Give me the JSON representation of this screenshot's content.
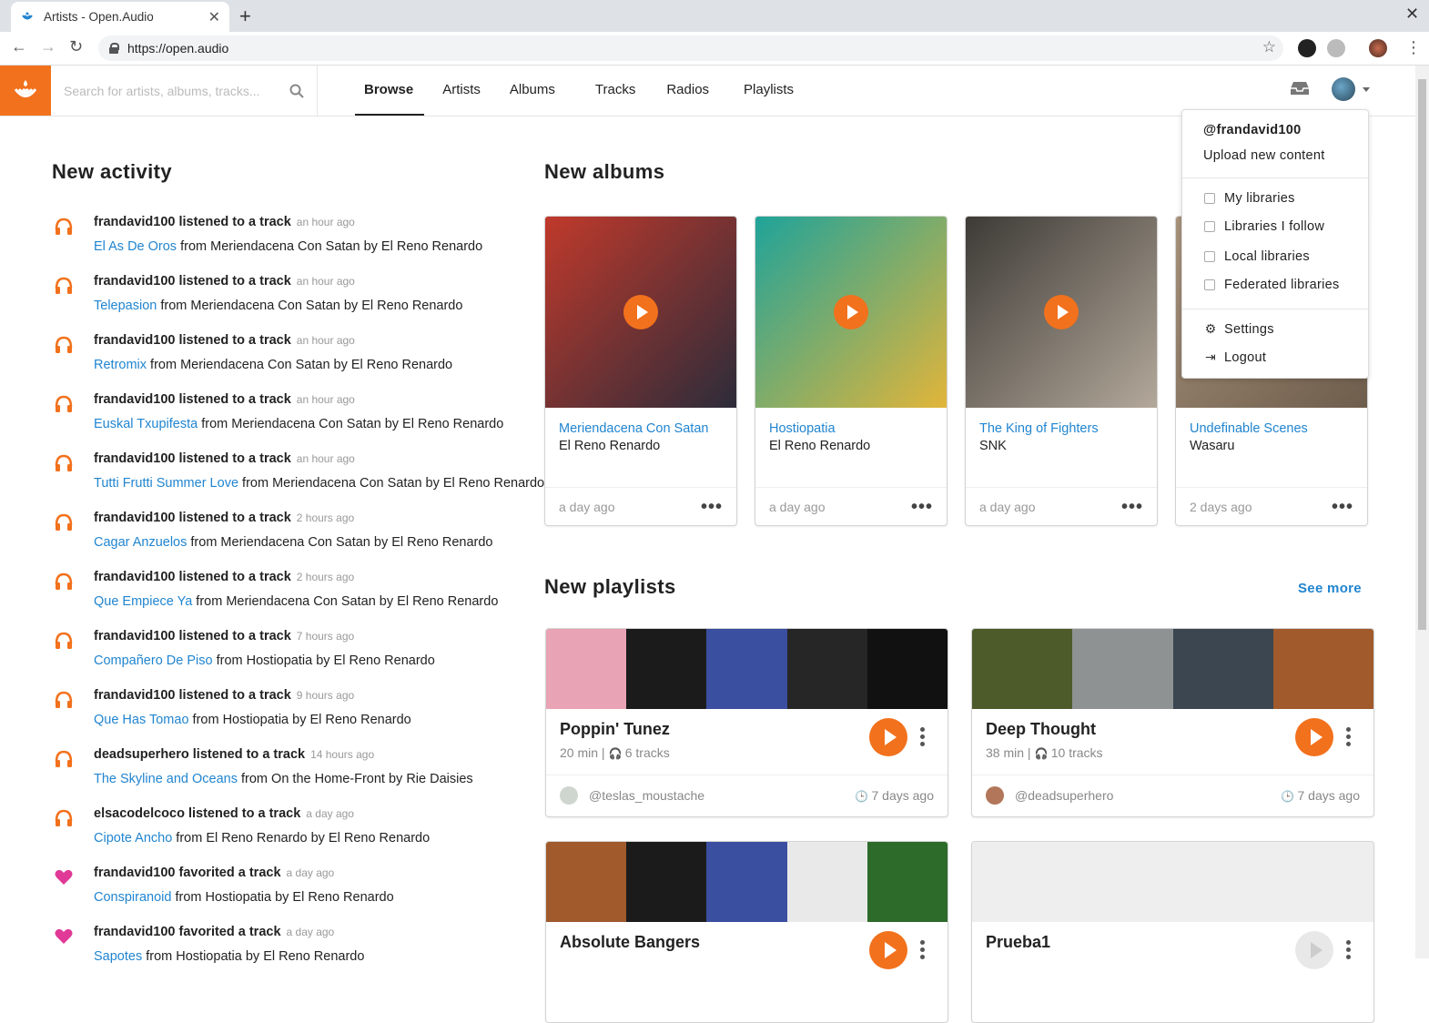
{
  "browser": {
    "tab_title": "Artists - Open.Audio",
    "url": "https://open.audio",
    "close_tab": "✕",
    "new_tab": "+"
  },
  "search": {
    "placeholder": "Search for artists, albums, tracks..."
  },
  "nav": [
    "Browse",
    "Artists",
    "Albums",
    "Tracks",
    "Radios",
    "Playlists"
  ],
  "user_menu": {
    "username": "@frandavid100",
    "upload": "Upload new content",
    "libraries": [
      "My libraries",
      "Libraries I follow",
      "Local libraries",
      "Federated libraries"
    ],
    "settings": "Settings",
    "logout": "Logout"
  },
  "activity": {
    "title": "New activity",
    "items": [
      {
        "icon": "headphones-icon",
        "actor": "frandavid100 listened to a track",
        "time": "an hour ago",
        "track": "El As De Oros",
        "rest": " from Meriendacena Con Satan by El Reno Renardo"
      },
      {
        "icon": "headphones-icon",
        "actor": "frandavid100 listened to a track",
        "time": "an hour ago",
        "track": "Telepasion",
        "rest": " from Meriendacena Con Satan by El Reno Renardo"
      },
      {
        "icon": "headphones-icon",
        "actor": "frandavid100 listened to a track",
        "time": "an hour ago",
        "track": "Retromix",
        "rest": " from Meriendacena Con Satan by El Reno Renardo"
      },
      {
        "icon": "headphones-icon",
        "actor": "frandavid100 listened to a track",
        "time": "an hour ago",
        "track": "Euskal Txupifesta",
        "rest": " from Meriendacena Con Satan by El Reno Renardo"
      },
      {
        "icon": "headphones-icon",
        "actor": "frandavid100 listened to a track",
        "time": "an hour ago",
        "track": "Tutti Frutti Summer Love",
        "rest": " from Meriendacena Con Satan by El Reno Renardo"
      },
      {
        "icon": "headphones-icon",
        "actor": "frandavid100 listened to a track",
        "time": "2 hours ago",
        "track": "Cagar Anzuelos",
        "rest": " from Meriendacena Con Satan by El Reno Renardo"
      },
      {
        "icon": "headphones-icon",
        "actor": "frandavid100 listened to a track",
        "time": "2 hours ago",
        "track": "Que Empiece Ya",
        "rest": " from Meriendacena Con Satan by El Reno Renardo"
      },
      {
        "icon": "headphones-icon",
        "actor": "frandavid100 listened to a track",
        "time": "7 hours ago",
        "track": "Compañero De Piso",
        "rest": " from Hostiopatia by El Reno Renardo"
      },
      {
        "icon": "headphones-icon",
        "actor": "frandavid100 listened to a track",
        "time": "9 hours ago",
        "track": "Que Has Tomao",
        "rest": " from Hostiopatia by El Reno Renardo"
      },
      {
        "icon": "headphones-icon",
        "actor": "deadsuperhero listened to a track",
        "time": "14 hours ago",
        "track": "The Skyline and Oceans",
        "rest": " from On the Home-Front by Rie Daisies"
      },
      {
        "icon": "headphones-icon",
        "actor": "elsacodelcoco listened to a track",
        "time": "a day ago",
        "track": "Cipote Ancho",
        "rest": " from El Reno Renardo by El Reno Renardo"
      },
      {
        "icon": "heart-icon",
        "actor": "frandavid100 favorited a track",
        "time": "a day ago",
        "track": "Conspiranoid",
        "rest": " from Hostiopatia by El Reno Renardo"
      },
      {
        "icon": "heart-icon",
        "actor": "frandavid100 favorited a track",
        "time": "a day ago",
        "track": "Sapotes",
        "rest": " from Hostiopatia by El Reno Renardo"
      }
    ]
  },
  "albums": {
    "title": "New albums",
    "items": [
      {
        "title": "Meriendacena Con Satan",
        "artist": "El Reno Renardo",
        "time": "a day ago",
        "cover_a": "#c0392b",
        "cover_b": "#2c2c3a"
      },
      {
        "title": "Hostiopatia",
        "artist": "El Reno Renardo",
        "time": "a day ago",
        "cover_a": "#1fa39a",
        "cover_b": "#e2b53a"
      },
      {
        "title": "The King of Fighters",
        "artist": "SNK",
        "time": "a day ago",
        "cover_a": "#3d3a36",
        "cover_b": "#b3a89a"
      },
      {
        "title": "Undefinable Scenes",
        "artist": "Wasaru",
        "time": "2 days ago",
        "cover_a": "#a8937c",
        "cover_b": "#6e5d4c"
      }
    ]
  },
  "playlists": {
    "title": "New playlists",
    "see_more": "See more",
    "items": [
      {
        "name": "Poppin' Tunez",
        "duration": "20 min",
        "tracks": "6 tracks",
        "owner": "@teslas_moustache",
        "time": "7 days ago",
        "covers": [
          "#e8a3b5",
          "#1b1b1b",
          "#3a4fa0",
          "#262626",
          "#111111"
        ]
      },
      {
        "name": "Deep Thought",
        "duration": "38 min",
        "tracks": "10 tracks",
        "owner": "@deadsuperhero",
        "time": "7 days ago",
        "covers": [
          "#4d5a2a",
          "#8e9293",
          "#3b4650",
          "#a05a2c"
        ]
      },
      {
        "name": "Absolute Bangers",
        "duration": "",
        "tracks": "",
        "owner": "",
        "time": "",
        "covers": [
          "#a05a2c",
          "#1b1b1b",
          "#3a4fa0",
          "#e9e9e9",
          "#2d6b2a"
        ]
      },
      {
        "name": "Prueba1",
        "duration": "",
        "tracks": "",
        "owner": "",
        "time": "",
        "covers": [
          "#eeeeee"
        ]
      }
    ]
  },
  "colors": {
    "accent": "#f2711c",
    "link": "#2185d0",
    "heart": "#e03997"
  }
}
